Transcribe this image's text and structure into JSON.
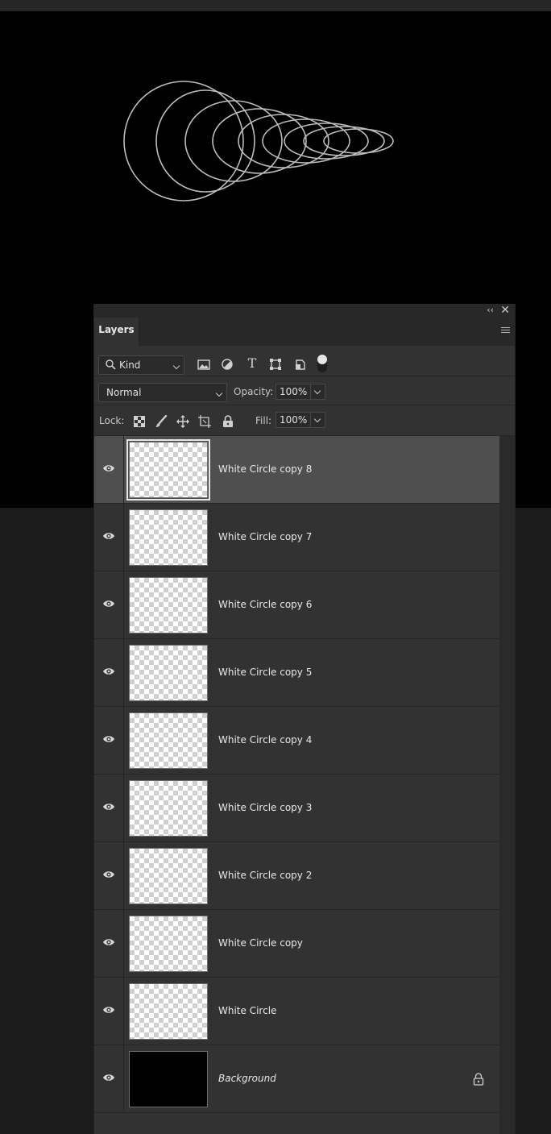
{
  "panel": {
    "tab_label": "Layers",
    "collapse_glyph": "‹‹",
    "close_glyph": "✕"
  },
  "filter": {
    "kind_label": "Kind",
    "icons": [
      "pixel-filter-icon",
      "adjustment-filter-icon",
      "type-filter-icon",
      "shape-filter-icon",
      "smart-object-filter-icon"
    ],
    "type_glyph": "T"
  },
  "blend": {
    "mode": "Normal",
    "opacity_label": "Opacity:",
    "opacity_value": "100%"
  },
  "lock": {
    "label": "Lock:",
    "icons": [
      "lock-transparent-pixels-icon",
      "lock-image-pixels-icon",
      "lock-position-icon",
      "lock-artboard-icon",
      "lock-all-icon"
    ],
    "fill_label": "Fill:",
    "fill_value": "100%"
  },
  "layers": [
    {
      "name": "White Circle copy 8",
      "selected": true,
      "thumb": "transparent"
    },
    {
      "name": "White Circle copy 7",
      "selected": false,
      "thumb": "transparent"
    },
    {
      "name": "White Circle copy 6",
      "selected": false,
      "thumb": "transparent"
    },
    {
      "name": "White Circle copy 5",
      "selected": false,
      "thumb": "transparent"
    },
    {
      "name": "White Circle copy 4",
      "selected": false,
      "thumb": "transparent"
    },
    {
      "name": "White Circle copy 3",
      "selected": false,
      "thumb": "transparent"
    },
    {
      "name": "White Circle copy 2",
      "selected": false,
      "thumb": "transparent"
    },
    {
      "name": "White Circle copy",
      "selected": false,
      "thumb": "transparent"
    },
    {
      "name": "White Circle",
      "selected": false,
      "thumb": "transparent"
    },
    {
      "name": "Background",
      "selected": false,
      "thumb": "black",
      "locked": true
    }
  ],
  "colors": {
    "canvas": "#000000",
    "circle_stroke": "#bdbdbd",
    "panel_bg": "#323232",
    "selected_row": "#4f4f4f"
  }
}
